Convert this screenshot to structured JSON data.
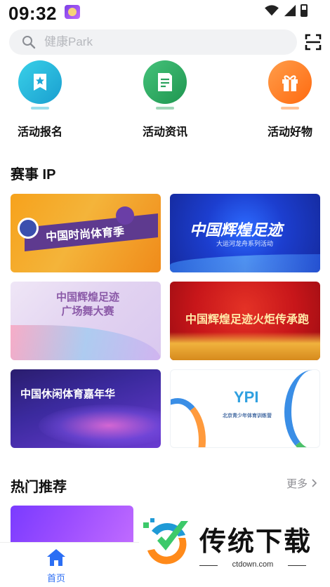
{
  "status_bar": {
    "time": "09:32"
  },
  "search": {
    "placeholder": "健康Park"
  },
  "shortcuts": [
    {
      "label": "活动报名",
      "icon": "star-card-icon",
      "color": "#21b7d8"
    },
    {
      "label": "活动资讯",
      "icon": "document-icon",
      "color": "#2fa864"
    },
    {
      "label": "活动好物",
      "icon": "gift-icon",
      "color": "#ff7a1a"
    }
  ],
  "ip_section": {
    "title": "赛事 IP",
    "cards": [
      {
        "title": "中国时尚体育季"
      },
      {
        "title": "中国辉煌足迹",
        "subtitle": "大运河龙舟系列活动"
      },
      {
        "title": "中国辉煌足迹 广场舞大赛"
      },
      {
        "title": "中国辉煌足迹火炬传承跑"
      },
      {
        "title": "中国休闲体育嘉年华"
      },
      {
        "title": "北京青少年体育训练营",
        "logo": "YPI"
      }
    ]
  },
  "hot_section": {
    "title": "热门推荐",
    "more": "更多"
  },
  "watermark": {
    "brand": "传统下载",
    "url": "ctdown.com"
  },
  "bottom_nav": {
    "home_label": "首页",
    "active_color": "#2b6ef4"
  }
}
